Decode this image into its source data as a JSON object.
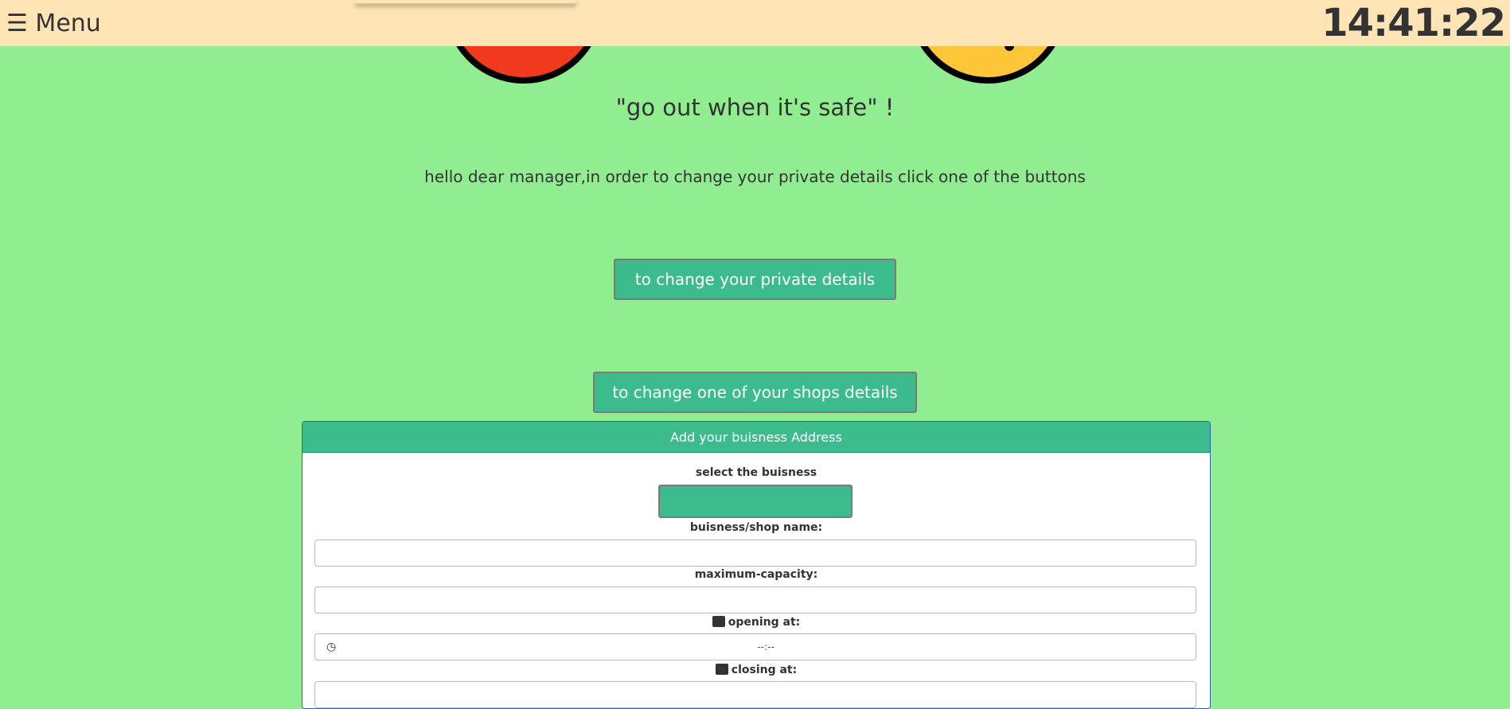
{
  "topbar": {
    "menu_icon": "hamburger-icon",
    "menu_label": "☰ Menu",
    "clock": "14:41:22"
  },
  "header": {
    "slogan": "\"go out when it's safe\" !",
    "intro": "hello dear manager,in order to change your private details click one of the buttons"
  },
  "buttons": {
    "private": "to change your private details",
    "shops": "to change one of your shops details"
  },
  "form": {
    "title": "Add your buisness Address",
    "select_label": "select the buisness",
    "name_label": "buisness/shop name:",
    "capacity_label": "maximum-capacity:",
    "opening_label": "opening at:",
    "opening_value": "--:--",
    "closing_label": "closing at:"
  },
  "colors": {
    "background": "#90ee90",
    "topbar": "#ffe4b5",
    "accent": "#3cbc8d"
  }
}
